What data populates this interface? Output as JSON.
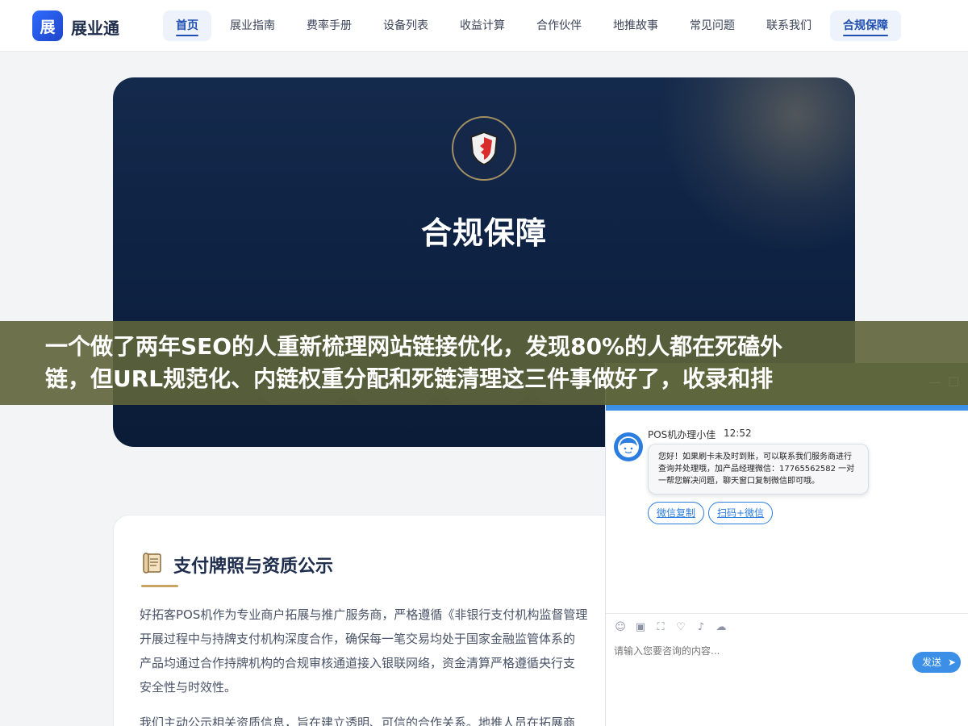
{
  "brand": {
    "logo_char": "展",
    "name": "展业通"
  },
  "nav": {
    "items": [
      {
        "label": "首页",
        "active": true
      },
      {
        "label": "展业指南",
        "active": false
      },
      {
        "label": "费率手册",
        "active": false
      },
      {
        "label": "设备列表",
        "active": false
      },
      {
        "label": "收益计算",
        "active": false
      },
      {
        "label": "合作伙伴",
        "active": false
      },
      {
        "label": "地推故事",
        "active": false
      },
      {
        "label": "常见问题",
        "active": false
      },
      {
        "label": "联系我们",
        "active": false
      },
      {
        "label": "合规保障",
        "active": true
      }
    ]
  },
  "hero": {
    "title": "合规保障",
    "icon": "shield-icon"
  },
  "section": {
    "icon": "scroll-icon",
    "title": "支付牌照与资质公示",
    "paragraph1_lines": [
      "好拓客POS机作为专业商户拓展与推广服务商，严格遵循《非银行支付机构监督管理",
      "开展过程中与持牌支付机构深度合作，确保每一笔交易均处于国家金融监管体系的",
      "产品均通过合作持牌机构的合规审核通道接入银联网络，资金清算严格遵循央行支",
      "安全性与时效性。"
    ],
    "paragraph2": "我们主动公示相关资质信息，旨在建立透明、可信的合作关系。地推人员在拓展商"
  },
  "banner": {
    "line1": "一个做了两年SEO的人重新梳理网站链接优化，发现80%的人都在死磕外",
    "line2": "链，但URL规范化、内链权重分配和死链清理这三件事做好了，收录和排"
  },
  "chat": {
    "agent_name": "POS机办理小佳",
    "time": "12:52",
    "message": "您好！如果刷卡未及时到账，可以联系我们服务商进行查询并处理哦，加产品经理微信：17765562582 一对一帮您解决问题，聊天窗口复制微信即可哦。",
    "buttons": [
      "微信复制",
      "扫码+微信"
    ],
    "input_placeholder": "请输入您要咨询的内容...",
    "send_label": "发送",
    "colors": {
      "accent": "#3b8fe6",
      "header": "#5f7f66"
    }
  }
}
